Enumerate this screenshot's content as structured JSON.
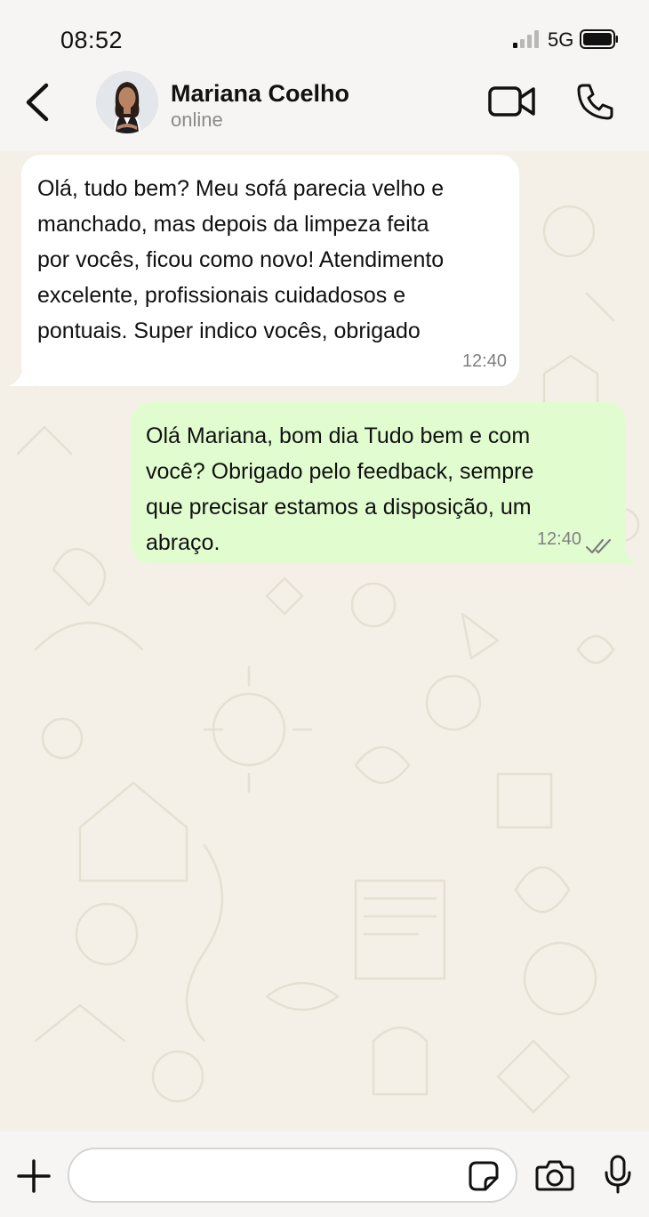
{
  "status_bar": {
    "time": "08:52",
    "network": "5G",
    "icons": [
      "signal-icon",
      "battery-icon"
    ]
  },
  "header": {
    "contact_name": "Mariana Coelho",
    "contact_status": "online",
    "icons": [
      "back-icon",
      "avatar",
      "video-camera-icon",
      "phone-icon"
    ]
  },
  "messages": [
    {
      "direction": "incoming",
      "lines": [
        "Olá, tudo bem? Meu sofá parecia velho e",
        "manchado, mas depois da limpeza feita",
        "por vocês, ficou como novo! Atendimento",
        "excelente, profissionais cuidadosos e",
        "pontuais. Super indico vocês, obrigado"
      ],
      "time": "12:40"
    },
    {
      "direction": "outgoing",
      "lines": [
        "Olá Mariana, bom dia Tudo bem e com",
        "você? Obrigado pelo feedback, sempre",
        "que precisar estamos a disposição, um",
        "abraço."
      ],
      "time": "12:40",
      "read_icon": "double-check-icon"
    }
  ],
  "input_bar": {
    "placeholder": "",
    "icons": [
      "plus-icon",
      "sticker-icon",
      "camera-icon",
      "microphone-icon"
    ]
  },
  "colors": {
    "background": "#f6f5f3",
    "chat_background": "#f4f0e8",
    "incoming_bubble": "#ffffff",
    "outgoing_bubble": "#e1fdd0",
    "secondary_text": "#8a8a8a"
  }
}
